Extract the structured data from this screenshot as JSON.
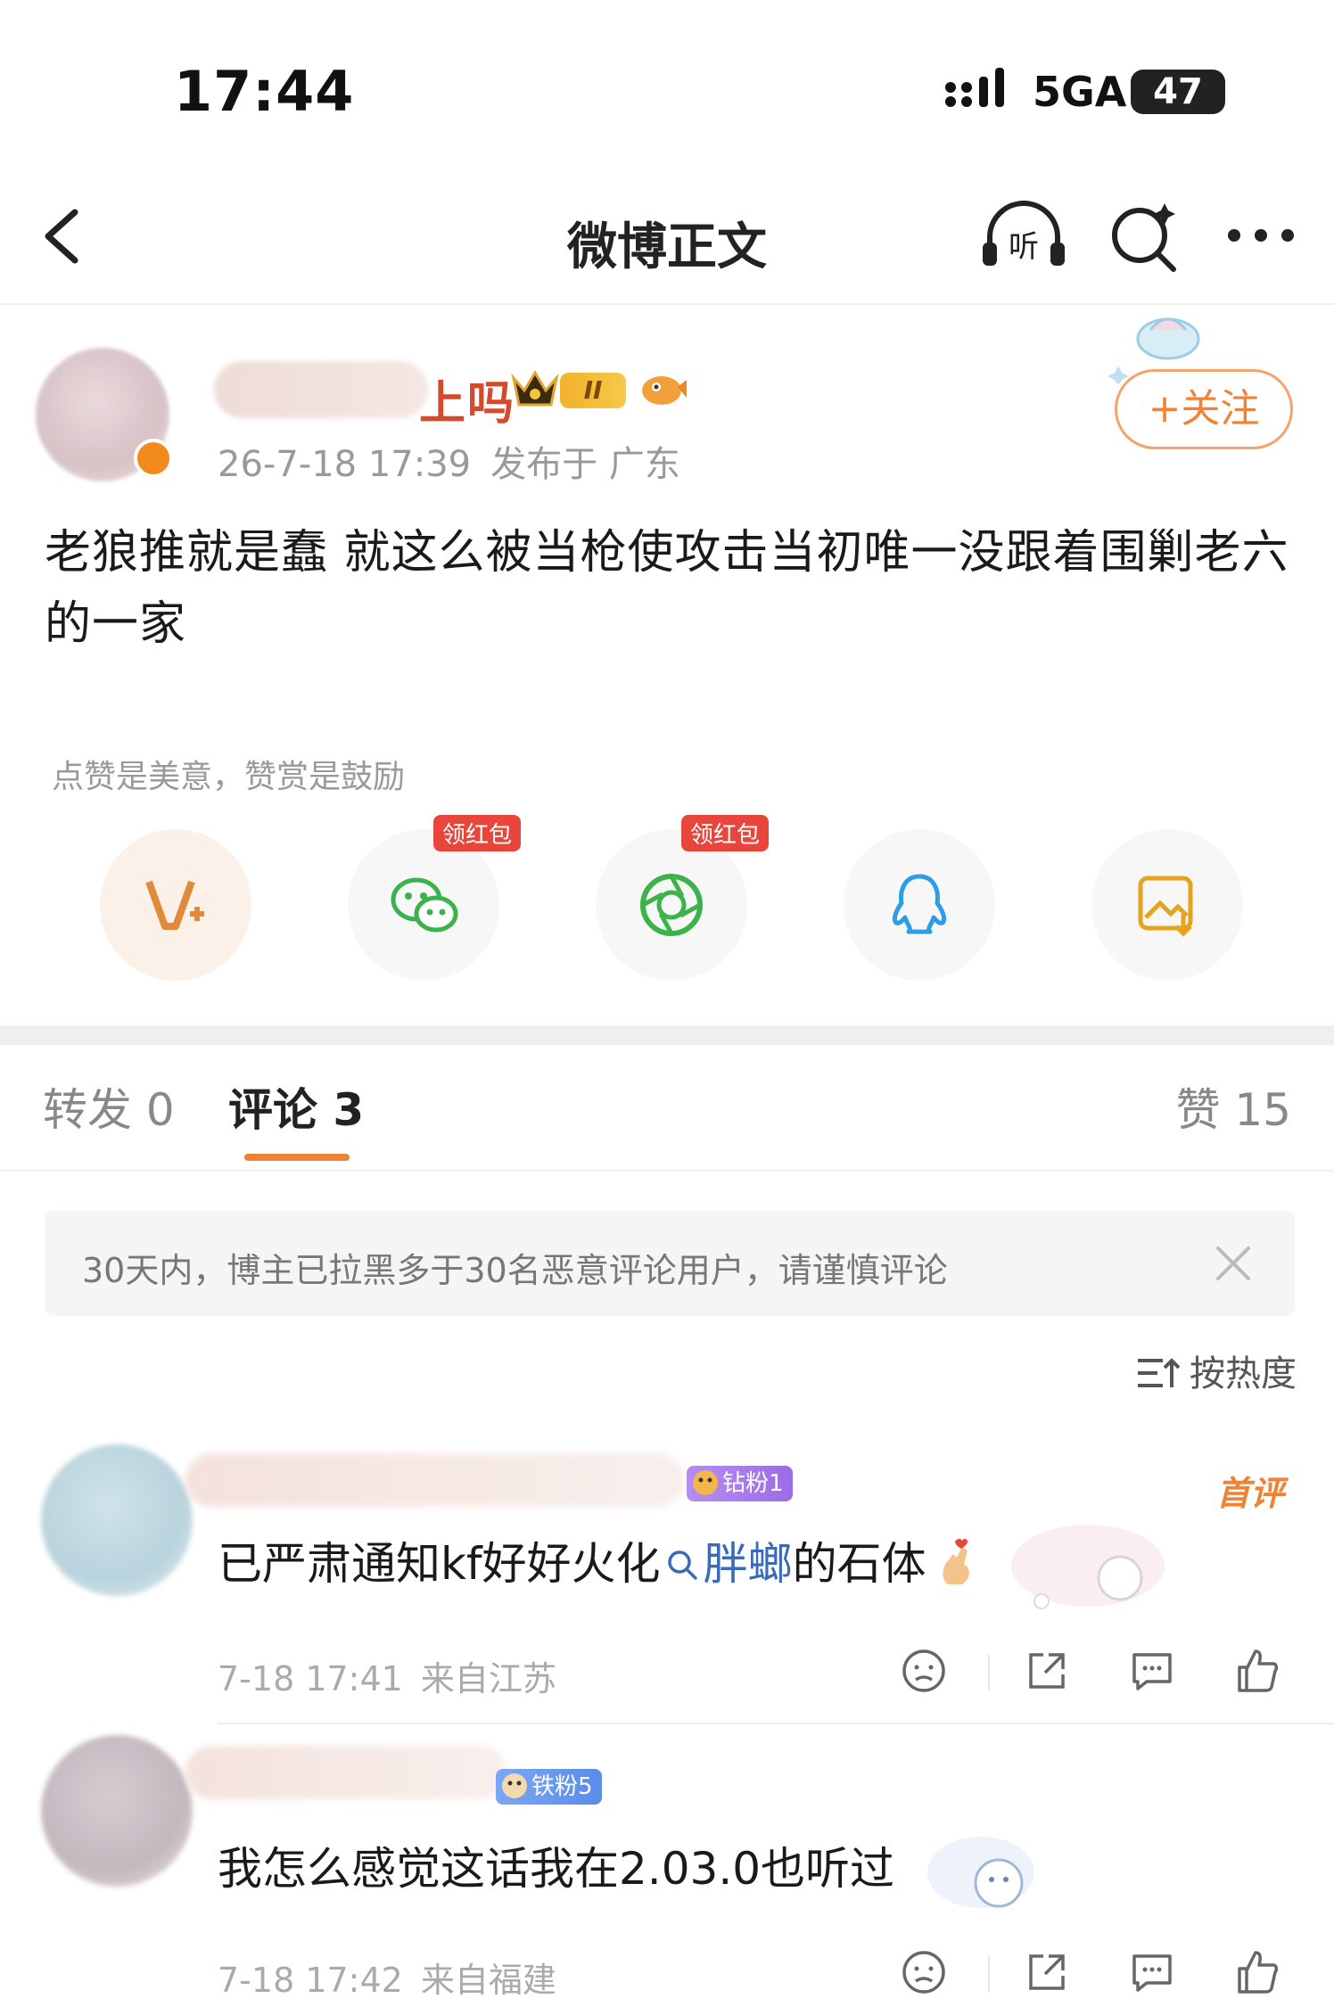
{
  "status_bar": {
    "time": "17:44",
    "network": "5GA",
    "battery": "47"
  },
  "nav": {
    "title": "微博正文",
    "listen_label": "听"
  },
  "post": {
    "author_name_tail": "上吗",
    "level": "II",
    "timestamp": "26-7-18 17:39",
    "location": "发布于 广东",
    "follow_label": "+关注",
    "body": "老狼推就是蠢 就这么被当枪使攻击当初唯一没跟着围剿老六的一家"
  },
  "reward": {
    "hint": "点赞是美意，赞赏是鼓励",
    "share_items": [
      {
        "icon": "vip-reward-icon"
      },
      {
        "icon": "wechat-icon",
        "badge": "领红包"
      },
      {
        "icon": "moments-icon",
        "badge": "领红包"
      },
      {
        "icon": "qq-icon"
      },
      {
        "icon": "save-image-icon"
      }
    ]
  },
  "tabs": {
    "repost": "转发 0",
    "comment": "评论 3",
    "like": "赞 15"
  },
  "notice": {
    "text": "30天内，博主已拉黑多于30名恶意评论用户，请谨慎评论"
  },
  "sort": {
    "label": "按热度"
  },
  "comments": [
    {
      "fan_badge": "钻粉1",
      "first_tag": "首评",
      "text_before": "已严肃通知kf好好火化",
      "text_link": "胖螂",
      "text_after": "的石体",
      "timestamp": "7-18 17:41",
      "location": "来自江苏"
    },
    {
      "fan_badge": "铁粉5",
      "text": "我怎么感觉这话我在2.03.0也听过",
      "timestamp": "7-18 17:42",
      "location": "来自福建"
    }
  ],
  "colors": {
    "accent": "#f08233",
    "link": "#3b6bb5",
    "hongbao": "#e8453c"
  }
}
